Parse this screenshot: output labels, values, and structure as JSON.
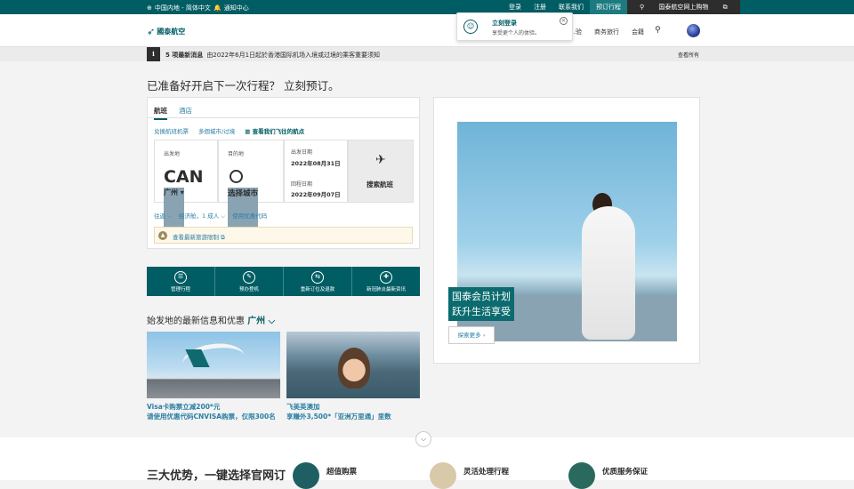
{
  "topbar": {
    "region": "中国内地 - 简体中文",
    "notice_center": "通知中心",
    "login": "登录",
    "register": "注册",
    "contact": "联系我们",
    "manage_booking": "预订行程",
    "shop": "国泰航空网上购物"
  },
  "nav": {
    "logo_text": "國泰航空",
    "links": [
      "…验",
      "商务旅行",
      "会籍"
    ],
    "search_icon": "search-icon"
  },
  "popup": {
    "title": "立刻登录",
    "subtitle": "享受更个人的体验。",
    "close": "✕"
  },
  "news": {
    "icon": "i",
    "label": "5 项最新消息",
    "text": "由2022年6月1日起於香港国际机场入境或过境的乘客重要须知",
    "view_all": "查看所有"
  },
  "headline": "已准备好开启下一次行程？ 立刻预订。",
  "booking": {
    "tab_flights": "航班",
    "tab_hotels": "酒店",
    "redeem": "兑换航班机票",
    "multi_city": "多個城市/过境",
    "destinations": "查看我们飞往的航点",
    "from_label": "出发地",
    "from_code": "CAN",
    "from_city": "广州 ▾",
    "to_label": "目的地",
    "to_city": "选择城市",
    "depart_label": "出发日期",
    "depart_date": "2022年08月31日",
    "return_label": "回程日期",
    "return_date": "2022年09月07日",
    "search_button": "搜索航班",
    "trip_type": "往返 ⌵",
    "cabin_pax": "经济舱，1 成人 ⌵",
    "promo": "使用优惠代码",
    "travel_alert": "查看最新旅游限制 ⧉"
  },
  "quick_links": [
    {
      "label": "管理行程",
      "icon": "manage-icon"
    },
    {
      "label": "预办登机",
      "icon": "checkin-icon"
    },
    {
      "label": "重新订位及退款",
      "icon": "rebook-icon"
    },
    {
      "label": "新冠肺炎最新资讯",
      "icon": "shield-icon"
    }
  ],
  "deals": {
    "title": "始发地的最新信息和优惠",
    "city": "广州 ⌵",
    "card1_line1": "Visa卡购票立减200*元",
    "card1_line2": "请使用优惠代码CNVISA购票，仅限300名",
    "card2_line1": "飞美英澳加",
    "card2_line2": "享赚外3,500*「亚洲万里通」里数"
  },
  "hero": {
    "tag_line1": "国泰会员计划",
    "tag_line2": "跃升生活享受",
    "more": "探索更多 ›"
  },
  "advantages": {
    "title": "三大优势，一键选择官网订",
    "items": [
      "超值购票",
      "灵活处理行程",
      "优质服务保证"
    ]
  },
  "colors": {
    "brand": "#005d63",
    "link": "#2a7ea3"
  }
}
